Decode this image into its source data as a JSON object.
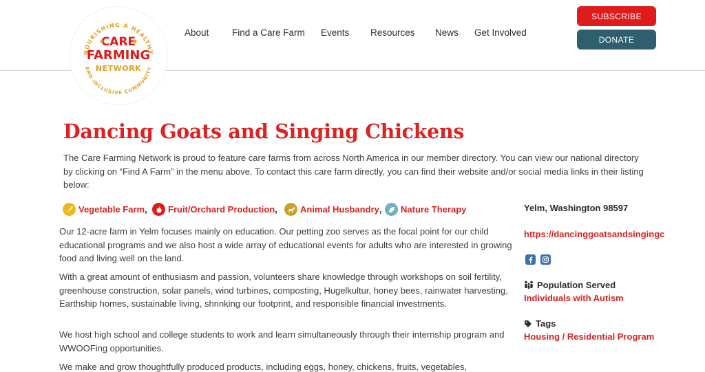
{
  "logo": {
    "top_arc": "NOURISHING A HEALTHY",
    "line1": "CARE",
    "line2": "FARMING",
    "line3": "NETWORK",
    "bottom_arc": "AND INCLUSIVE COMMUNITY",
    "colors": {
      "red": "#df1c1b",
      "gold": "#e0a022"
    }
  },
  "nav": {
    "items": [
      "About",
      "Find a Care Farm",
      "Events",
      "Resources",
      "News",
      "Get Involved"
    ]
  },
  "buttons": {
    "subscribe": "SUBSCRIBE",
    "donate": "DONATE"
  },
  "page": {
    "title": "Dancing Goats and Singing Chickens",
    "intro": "The Care Farming Network is proud to feature care farms from across North America in our member directory. You can view our national directory by clicking on “Find A Farm” in the menu above. To contact this care farm directly, you can find their website and/or social media links in their listing below:",
    "categories": [
      {
        "label": "Vegetable Farm",
        "icon": "carrot-icon",
        "color": "#f0b71c"
      },
      {
        "label": "Fruit/Orchard Production",
        "icon": "apple-icon",
        "color": "#df1c1b"
      },
      {
        "label": "Animal Husbandry",
        "icon": "goat-icon",
        "color": "#c9a227"
      },
      {
        "label": "Nature Therapy",
        "icon": "leaf-icon",
        "color": "#6fb0c3"
      }
    ],
    "separator": ",",
    "paragraphs": [
      "Our 12-acre farm in Yelm focuses mainly on education. Our petting zoo serves as the focal point for our child educational programs and we also host a wide array of educational events for adults who are interested in growing food and living well on the land.",
      "With a great amount of enthusiasm and passion, volunteers share knowledge through workshops on soil fertility, greenhouse construction, solar panels, wind turbines, composting, Hugelkultur, honey bees, rainwater harvesting, Earthship homes, sustainable living, shrinking our footprint, and responsible financial investments.",
      "We host high school and college students to work and learn simultaneously through their internship program and WWOOFing opportunities.",
      "We make and grow thoughtfully produced products, including eggs, honey, chickens, fruits, vegetables,"
    ]
  },
  "sidebar": {
    "location": "Yelm, Washington 98597",
    "website": "https://dancinggoatsandsingingc",
    "social_icons": [
      "facebook-icon",
      "instagram-icon"
    ],
    "population_heading": "Population Served",
    "population_value": "Individuals with Autism",
    "tags_heading": "Tags",
    "tags_value": "Housing / Residential Program"
  }
}
